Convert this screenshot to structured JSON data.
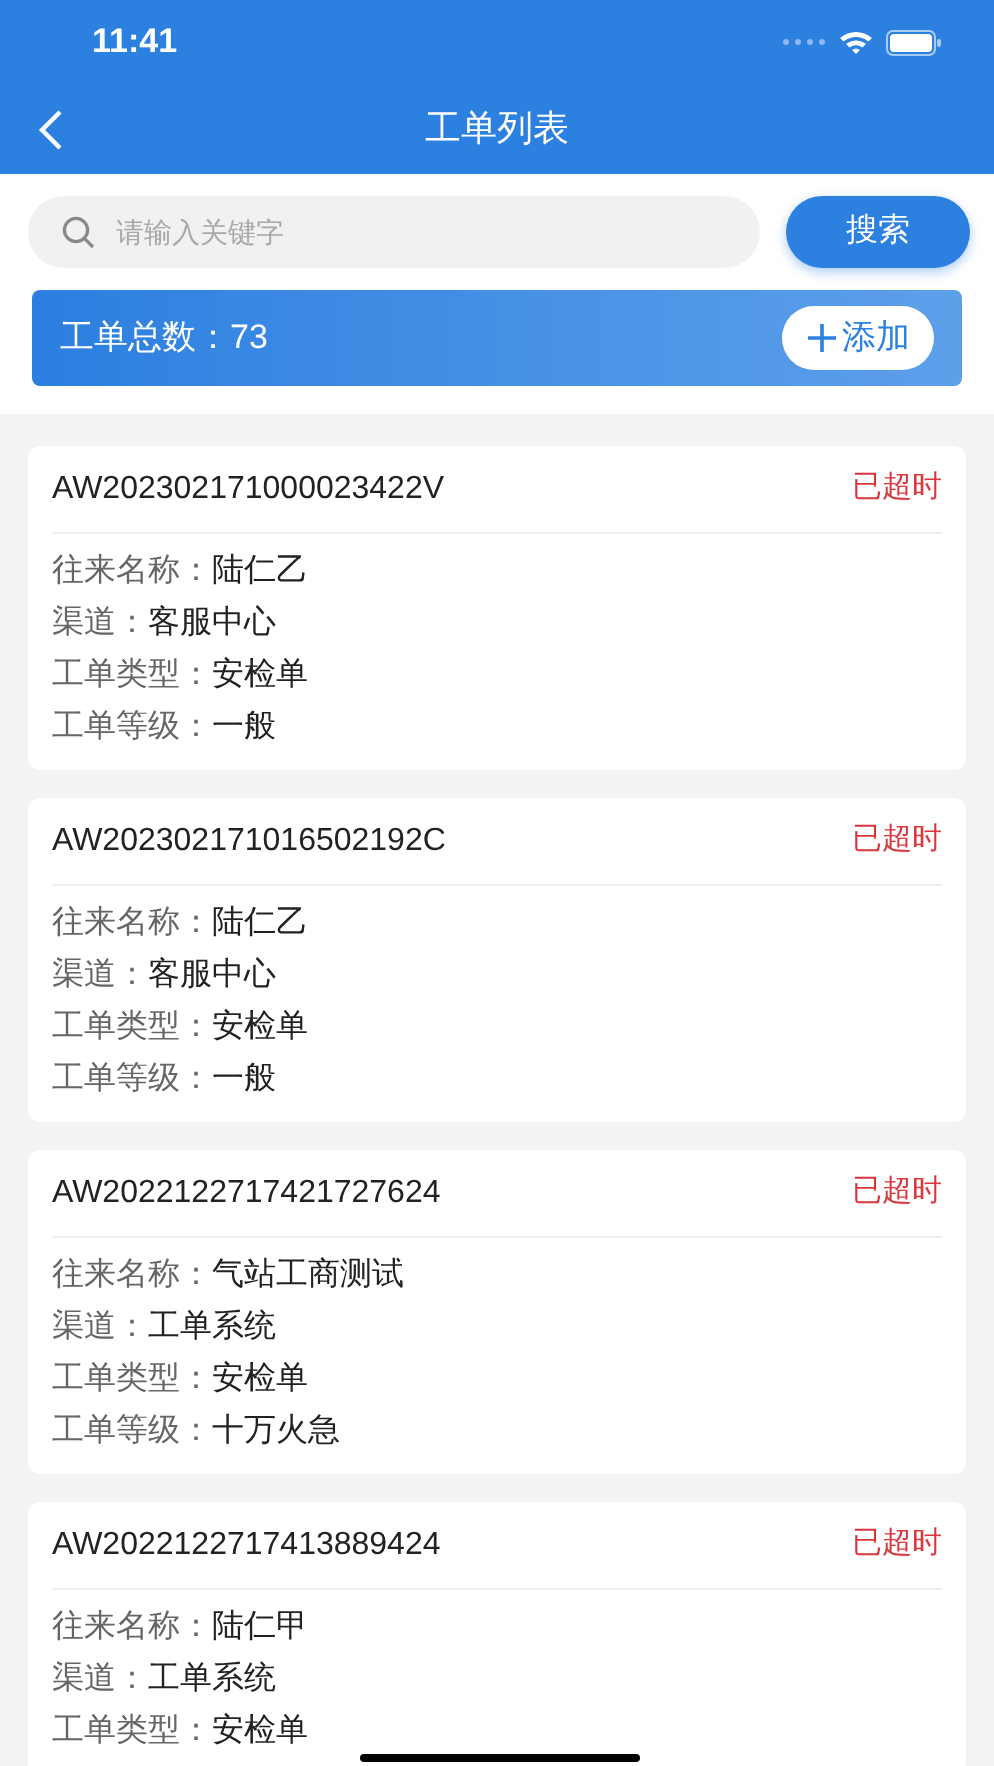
{
  "status_bar": {
    "time": "11:41"
  },
  "nav": {
    "title": "工单列表"
  },
  "search": {
    "placeholder": "请输入关键字",
    "button": "搜索"
  },
  "summary": {
    "label": "工单总数：73",
    "add_button": "添加"
  },
  "orders": [
    {
      "id": "AW202302171000023422V",
      "status": "已超时",
      "fields": [
        {
          "label": "往来名称：",
          "value": "陆仁乙"
        },
        {
          "label": "渠道：",
          "value": "客服中心"
        },
        {
          "label": "工单类型：",
          "value": "安检单"
        },
        {
          "label": "工单等级：",
          "value": "一般"
        }
      ]
    },
    {
      "id": "AW202302171016502192C",
      "status": "已超时",
      "fields": [
        {
          "label": "往来名称：",
          "value": "陆仁乙"
        },
        {
          "label": "渠道：",
          "value": "客服中心"
        },
        {
          "label": "工单类型：",
          "value": "安检单"
        },
        {
          "label": "工单等级：",
          "value": "一般"
        }
      ]
    },
    {
      "id": "AW2022122717421727624",
      "status": "已超时",
      "fields": [
        {
          "label": "往来名称：",
          "value": "气站工商测试"
        },
        {
          "label": "渠道：",
          "value": "工单系统"
        },
        {
          "label": "工单类型：",
          "value": "安检单"
        },
        {
          "label": "工单等级：",
          "value": "十万火急"
        }
      ]
    },
    {
      "id": "AW2022122717413889424",
      "status": "已超时",
      "fields": [
        {
          "label": "往来名称：",
          "value": "陆仁甲"
        },
        {
          "label": "渠道：",
          "value": "工单系统"
        },
        {
          "label": "工单类型：",
          "value": "安检单"
        }
      ]
    }
  ]
}
